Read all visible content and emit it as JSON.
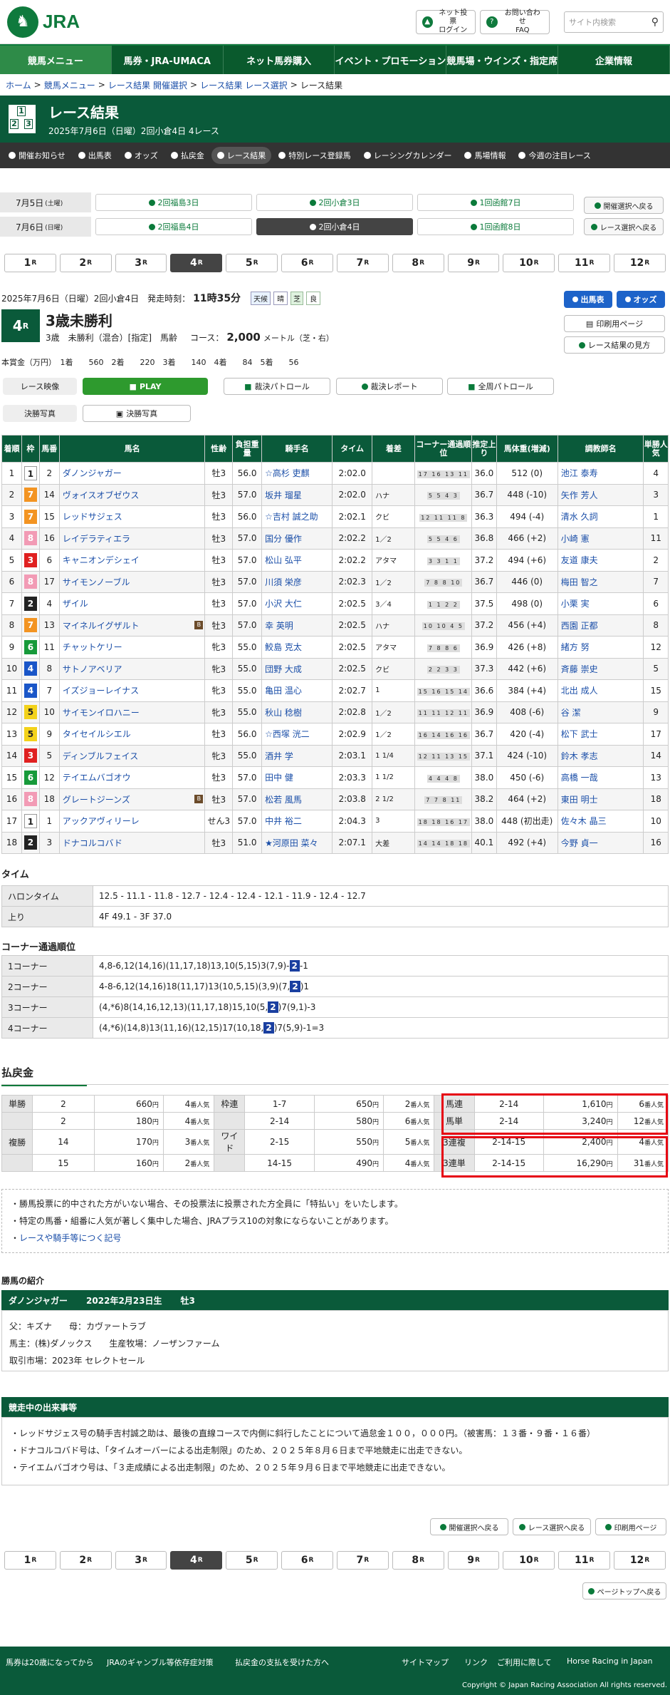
{
  "header": {
    "logo": "JRA",
    "login": "ネット投票\nログイン",
    "faq": "お問い合わせ\nFAQ",
    "search_placeholder": "サイト内検索"
  },
  "gnav": [
    "競馬メニュー",
    "馬券・JRA-UMACA",
    "ネット馬券購入",
    "イベント・プロモーション",
    "競馬場・ウインズ・指定席",
    "企業情報"
  ],
  "breadcrumb": [
    "ホーム",
    "競馬メニュー",
    "レース結果 開催選択",
    "レース結果 レース選択",
    "レース結果"
  ],
  "title": {
    "main": "レース結果",
    "sub": "2025年7月6日（日曜）2回小倉4日 4レース"
  },
  "subnav": [
    "開催お知らせ",
    "出馬表",
    "オッズ",
    "払戻金",
    "レース結果",
    "特別レース登録馬",
    "レーシングカレンダー",
    "馬場情報",
    "今週の注目レース"
  ],
  "days": [
    {
      "label": "7月5日",
      "dow": "(土曜)",
      "btns": [
        "2回福島3日",
        "2回小倉3日",
        "1回函館7日"
      ]
    },
    {
      "label": "7月6日",
      "dow": "(日曜)",
      "btns": [
        "2回福島4日",
        "2回小倉4日",
        "1回函館8日"
      ]
    }
  ],
  "day_side": [
    "開催選択へ戻る",
    "レース選択へ戻る"
  ],
  "races": [
    "1",
    "2",
    "3",
    "4",
    "5",
    "6",
    "7",
    "8",
    "9",
    "10",
    "11",
    "12"
  ],
  "race_suffix": "R",
  "info": {
    "date": "2025年7月6日（日曜）2回小倉4日　発走時刻：",
    "time": "11時35分",
    "weather_l": "天候",
    "weather": "晴",
    "track_l": "芝",
    "track": "良",
    "rno": "4",
    "rs": "R",
    "name": "3歳未勝利",
    "cond": "3歳　未勝利（混合）[指定]　馬齢",
    "course_l": "コース：",
    "dist": "2,000",
    "unit": "メートル（芝・右）",
    "prize": "本賞金（万円）　1着　　560　2着　　220　3着　　140　4着　　84　5着　　56"
  },
  "buttons": {
    "entries": "出馬表",
    "odds": "オッズ",
    "print": "印刷用ページ",
    "howto": "レース結果の見方",
    "video": "レース映像",
    "play": "PLAY",
    "patrol": "裁決パトロール",
    "report": "裁決レポート",
    "fullpatrol": "全周パトロール",
    "photo": "決勝写真",
    "photo2": "決勝写真"
  },
  "table_headers": [
    "着順",
    "枠",
    "馬番",
    "馬名",
    "性齢",
    "負担重量",
    "騎手名",
    "タイム",
    "着差",
    "コーナー通過順位",
    "推定上り",
    "馬体重(増減)",
    "調教師名",
    "単勝人気"
  ],
  "results": [
    [
      "1",
      "1",
      "2",
      "ダノンジャガー",
      "牡3",
      "56.0",
      "☆高杉 吏麒",
      "2:02.0",
      "",
      "17 16 13 11",
      "36.0",
      "512 (0)",
      "池江 泰寿",
      "4"
    ],
    [
      "2",
      "7",
      "14",
      "ヴォイスオブゼウス",
      "牡3",
      "57.0",
      "坂井 瑠星",
      "2:02.0",
      "ハナ",
      "5 5 4 3",
      "36.7",
      "448 (-10)",
      "矢作 芳人",
      "3"
    ],
    [
      "3",
      "7",
      "15",
      "レッドサジェス",
      "牡3",
      "56.0",
      "☆吉村 誠之助",
      "2:02.1",
      "クビ",
      "12 11 11 8",
      "36.3",
      "494 (-4)",
      "清水 久詞",
      "1"
    ],
    [
      "4",
      "8",
      "16",
      "レイデラティエラ",
      "牡3",
      "57.0",
      "国分 優作",
      "2:02.2",
      "1／2",
      "5 5 4 6",
      "36.8",
      "466 (+2)",
      "小崎 憲",
      "11"
    ],
    [
      "5",
      "3",
      "6",
      "キャニオンデシェイ",
      "牡3",
      "57.0",
      "松山 弘平",
      "2:02.2",
      "アタマ",
      "3 3 1 1",
      "37.2",
      "494 (+6)",
      "友道 康夫",
      "2"
    ],
    [
      "6",
      "8",
      "17",
      "サイモンノーブル",
      "牡3",
      "57.0",
      "川須 栄彦",
      "2:02.3",
      "1／2",
      "7 8 8 10",
      "36.7",
      "446 (0)",
      "梅田 智之",
      "7"
    ],
    [
      "7",
      "2",
      "4",
      "ザイル",
      "牡3",
      "57.0",
      "小沢 大仁",
      "2:02.5",
      "3／4",
      "1 1 2 2",
      "37.5",
      "498 (0)",
      "小栗 実",
      "6"
    ],
    [
      "8",
      "7",
      "13",
      "マイネルイグザルト",
      "牡3",
      "57.0",
      "幸 英明",
      "2:02.5",
      "ハナ",
      "10 10 4 5",
      "37.2",
      "456 (+4)",
      "西園 正都",
      "8"
    ],
    [
      "9",
      "6",
      "11",
      "チャットケリー",
      "牝3",
      "55.0",
      "鮫島 克太",
      "2:02.5",
      "アタマ",
      "7 8 8 6",
      "36.9",
      "426 (+8)",
      "緒方 努",
      "12"
    ],
    [
      "10",
      "4",
      "8",
      "サトノアベリア",
      "牝3",
      "55.0",
      "団野 大成",
      "2:02.5",
      "クビ",
      "2 2 3 3",
      "37.3",
      "442 (+6)",
      "斉藤 崇史",
      "5"
    ],
    [
      "11",
      "4",
      "7",
      "イズジョーレイナス",
      "牝3",
      "55.0",
      "亀田 温心",
      "2:02.7",
      "1",
      "15 16 15 14",
      "36.6",
      "384 (+4)",
      "北出 成人",
      "15"
    ],
    [
      "12",
      "5",
      "10",
      "サイモンイロハニー",
      "牝3",
      "55.0",
      "秋山 稔樹",
      "2:02.8",
      "1／2",
      "11 11 12 11",
      "36.9",
      "408 (-6)",
      "谷 潔",
      "9"
    ],
    [
      "13",
      "5",
      "9",
      "タイセイルシエル",
      "牡3",
      "56.0",
      "☆西塚 洸二",
      "2:02.9",
      "1／2",
      "16 14 16 16",
      "36.7",
      "420 (-4)",
      "松下 武士",
      "17"
    ],
    [
      "14",
      "3",
      "5",
      "ディンブルフェイス",
      "牝3",
      "55.0",
      "酒井 学",
      "2:03.1",
      "1 1/4",
      "12 11 13 15",
      "37.1",
      "424 (-10)",
      "鈴木 孝志",
      "14"
    ],
    [
      "15",
      "6",
      "12",
      "テイエムバゴオウ",
      "牡3",
      "57.0",
      "田中 健",
      "2:03.3",
      "1 1/2",
      "4 4 4 8",
      "38.0",
      "450 (-6)",
      "高橋 一哉",
      "13"
    ],
    [
      "16",
      "8",
      "18",
      "グレートジーンズ",
      "牡3",
      "57.0",
      "松若 風馬",
      "2:03.8",
      "2 1/2",
      "7 7 8 11",
      "38.2",
      "464 (+2)",
      "東田 明士",
      "18"
    ],
    [
      "17",
      "1",
      "1",
      "アックアヴィリーレ",
      "せん3",
      "57.0",
      "中井 裕二",
      "2:04.3",
      "3",
      "18 18 16 17",
      "38.0",
      "448 (初出走)",
      "佐々木 晶三",
      "10"
    ],
    [
      "18",
      "2",
      "3",
      "ドナコルコバド",
      "牡3",
      "51.0",
      "★河原田 菜々",
      "2:07.1",
      "大差",
      "14 14 18 18",
      "40.1",
      "492 (+4)",
      "今野 貞一",
      "16"
    ]
  ],
  "b_marks": [
    7,
    15
  ],
  "time_title": "タイム",
  "time": [
    {
      "k": "ハロンタイム",
      "v": "12.5 - 11.1 - 11.8 - 12.7 - 12.4 - 12.4 - 12.1 - 11.9 - 12.4 - 12.7"
    },
    {
      "k": "上り",
      "v": "4F 49.1 - 3F 37.0"
    }
  ],
  "corner_title": "コーナー通過順位",
  "corners": [
    {
      "k": "1コーナー",
      "v": "4,8-6,12(14,16)(11,17,18)13,10(5,15)3(7,9)-",
      "hl": "2",
      "t": "-1"
    },
    {
      "k": "2コーナー",
      "v": "4-8-6,12(14,16)18(11,17)13(10,5,15)(3,9)(7,",
      "hl": "2",
      "t": ")1"
    },
    {
      "k": "3コーナー",
      "v": "(4,*6)8(14,16,12,13)(11,17,18)15,10(5,",
      "hl": "2",
      "t": ")7(9,1)-3"
    },
    {
      "k": "4コーナー",
      "v": "(4,*6)(14,8)13(11,16)(12,15)17(10,18,",
      "hl": "2",
      "t": ")7(5,9)-1=3"
    }
  ],
  "pay_title": "払戻金",
  "pay_left": [
    {
      "k": "単勝",
      "n": "2",
      "v": "660",
      "u": "円",
      "p": "4",
      "pu": "番人気"
    },
    {
      "k": "",
      "n": "2",
      "v": "180",
      "u": "円",
      "p": "4",
      "pu": "番人気"
    },
    {
      "k": "複勝",
      "n": "14",
      "v": "170",
      "u": "円",
      "p": "3",
      "pu": "番人気"
    },
    {
      "k": "",
      "n": "15",
      "v": "160",
      "u": "円",
      "p": "2",
      "pu": "番人気"
    }
  ],
  "pay_mid": [
    {
      "k": "枠連",
      "n": "1-7",
      "v": "650",
      "u": "円",
      "p": "2",
      "pu": "番人気"
    },
    {
      "k": "",
      "n": "2-14",
      "v": "580",
      "u": "円",
      "p": "6",
      "pu": "番人気"
    },
    {
      "k": "ワイド",
      "n": "2-15",
      "v": "550",
      "u": "円",
      "p": "5",
      "pu": "番人気"
    },
    {
      "k": "",
      "n": "14-15",
      "v": "490",
      "u": "円",
      "p": "4",
      "pu": "番人気"
    }
  ],
  "pay_right": [
    {
      "k": "馬連",
      "n": "2-14",
      "v": "1,610",
      "u": "円",
      "p": "6",
      "pu": "番人気"
    },
    {
      "k": "馬単",
      "n": "2-14",
      "v": "3,240",
      "u": "円",
      "p": "12",
      "pu": "番人気"
    },
    {
      "k": "3連複",
      "n": "2-14-15",
      "v": "2,400",
      "u": "円",
      "p": "4",
      "pu": "番人気"
    },
    {
      "k": "3連単",
      "n": "2-14-15",
      "v": "16,290",
      "u": "円",
      "p": "31",
      "pu": "番人気"
    }
  ],
  "notes": [
    "勝馬投票に的中された方がいない場合、その投票法に投票された方全員に「特払い」をいたします。",
    "特定の馬番・組番に人気が著しく集中した場合、JRAプラス10の対象にならないことがあります。",
    "レースや騎手等につく記号"
  ],
  "winner_title": "勝馬の紹介",
  "winner": {
    "name": "ダノンジャガー",
    "born": "2022年2月23日生",
    "sex": "牡3",
    "l1": "父：キズナ　　母：カヴァートラブ",
    "l2": "馬主：(株)ダノックス　　生産牧場：ノーザンファーム",
    "l3": "取引市場：2023年 セレクトセール"
  },
  "events_title": "競走中の出来事等",
  "events": [
    "レッドサジェス号の騎手吉村誠之助は、最後の直線コースで内側に斜行したことについて過怠金１００，０００円。（被害馬：１３番・９番・１６番）",
    "ドナコルコバド号は、「タイムオーバーによる出走制限」のため、２０２５年８月６日まで平地競走に出走できない。",
    "テイエムバゴオウ号は、「３走成績による出走制限」のため、２０２５年９月６日まで平地競走に出走できない。"
  ],
  "bottom_btns": [
    "開催選択へ戻る",
    "レース選択へ戻る",
    "印刷用ページ"
  ],
  "pagetop": "ページトップへ戻る",
  "footer": {
    "links": [
      "馬券は20歳になってから",
      "JRAのギャンブル等依存症対策",
      "払戻金の支払を受けた方へ",
      "サイトマップ",
      "リンク",
      "ご利用に際して",
      "Horse Racing in Japan"
    ],
    "copy": "Copyright © Japan Racing Association All rights reserved."
  },
  "colors": {
    "green": "#0a5a3a",
    "frame": [
      "#ffffff",
      "#222222",
      "#e02020",
      "#1a56c8",
      "#f3d21a",
      "#179a3a",
      "#f39422",
      "#f29bb5"
    ]
  }
}
